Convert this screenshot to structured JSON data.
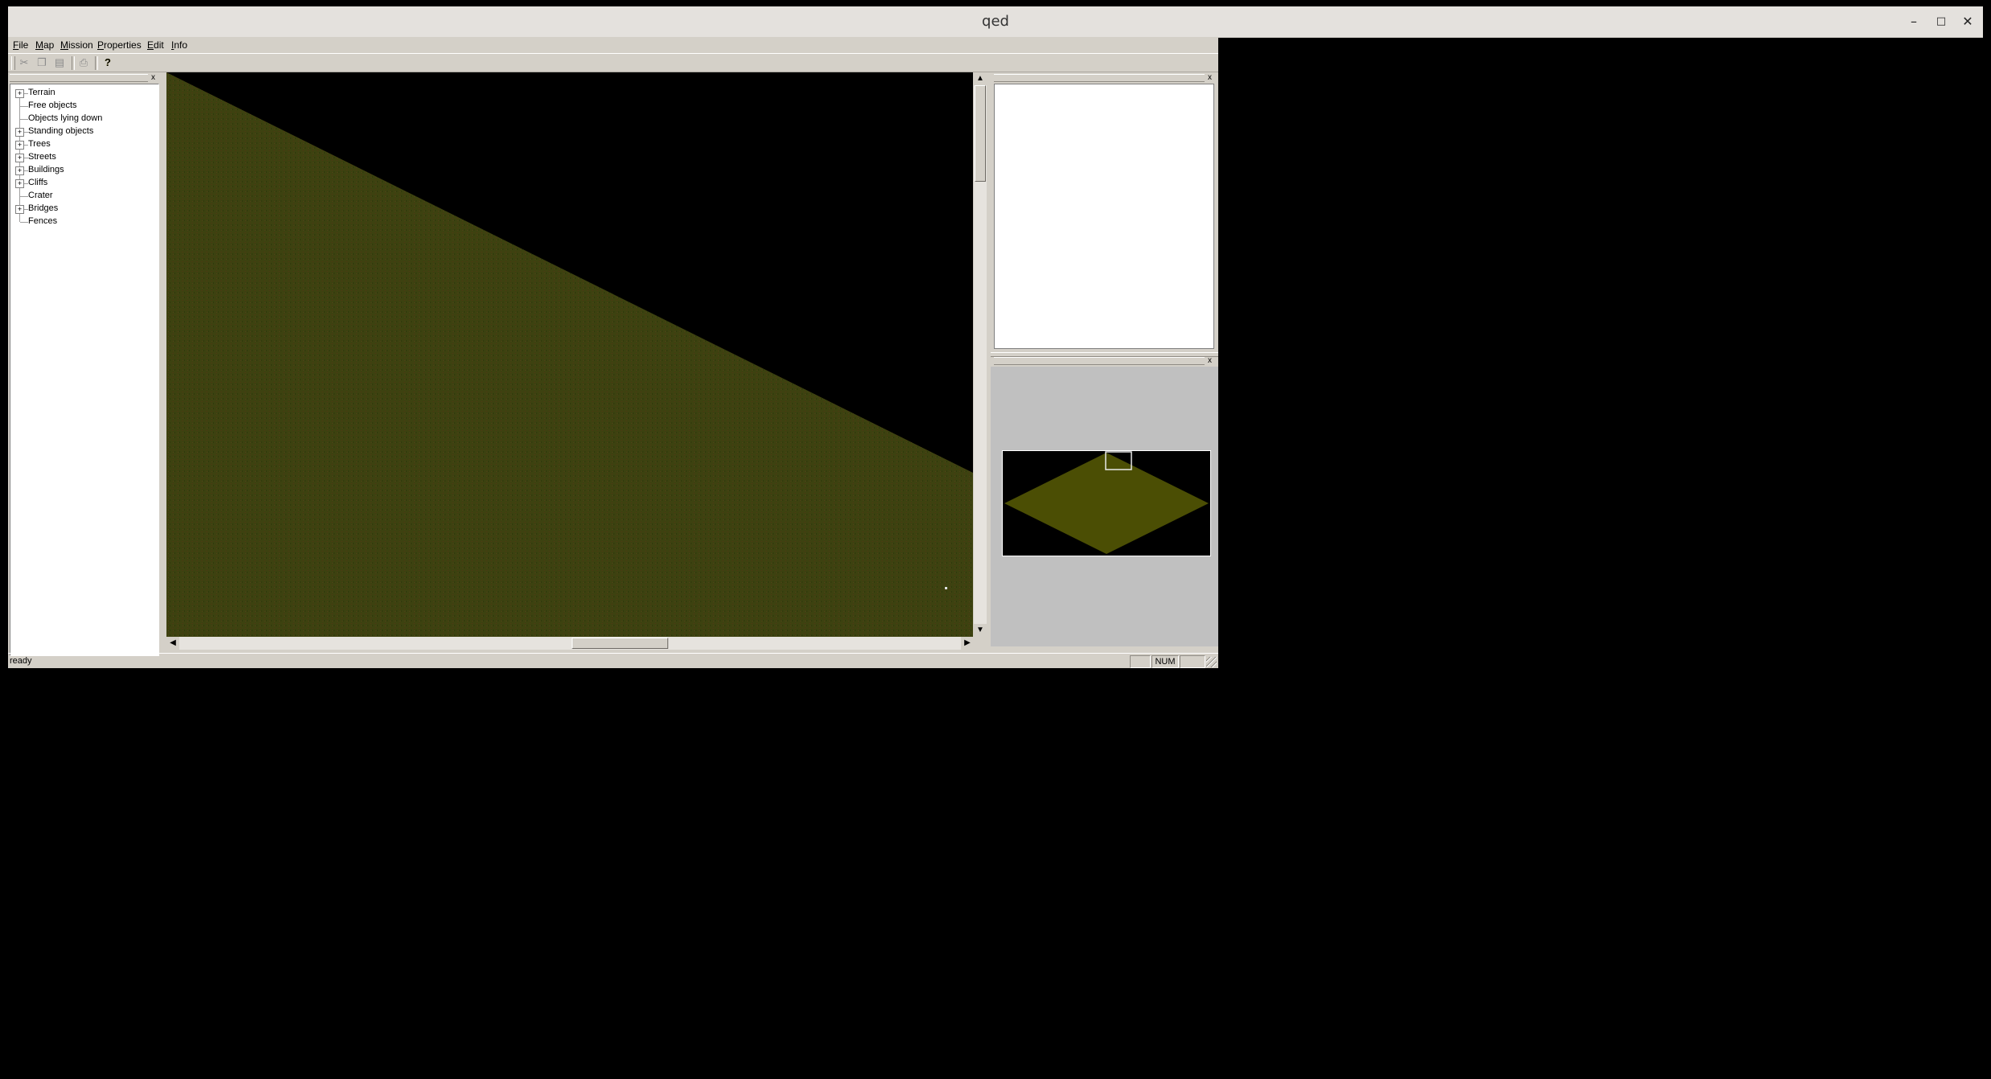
{
  "window": {
    "title": "qed",
    "controls": {
      "minimize": "–",
      "maximize": "□",
      "close": "✕"
    }
  },
  "menubar": {
    "items": [
      {
        "label": "File",
        "underline": "F"
      },
      {
        "label": "Map",
        "underline": "M"
      },
      {
        "label": "Mission",
        "underline": "M"
      },
      {
        "label": "Properties",
        "underline": "P"
      },
      {
        "label": "Edit",
        "underline": "E"
      },
      {
        "label": "Info",
        "underline": "I"
      }
    ]
  },
  "toolbar": {
    "buttons": [
      {
        "icon": "scissors-icon",
        "glyph": "✂"
      },
      {
        "icon": "copy-icon",
        "glyph": "❐"
      },
      {
        "icon": "paste-icon",
        "glyph": "▤"
      },
      {
        "icon": "print-icon",
        "glyph": "⎙"
      },
      {
        "icon": "help-icon",
        "glyph": "?"
      }
    ]
  },
  "object_tree": {
    "close": "x",
    "items": [
      {
        "label": "Terrain",
        "expandable": true
      },
      {
        "label": "Free objects",
        "expandable": false
      },
      {
        "label": "Objects lying down",
        "expandable": false
      },
      {
        "label": "Standing objects",
        "expandable": true
      },
      {
        "label": "Trees",
        "expandable": true
      },
      {
        "label": "Streets",
        "expandable": true
      },
      {
        "label": "Buildings",
        "expandable": true
      },
      {
        "label": "Cliffs",
        "expandable": true
      },
      {
        "label": "Crater",
        "expandable": false
      },
      {
        "label": "Bridges",
        "expandable": true
      },
      {
        "label": "Fences",
        "expandable": false
      }
    ]
  },
  "properties_panel": {
    "close": "x"
  },
  "minimap_panel": {
    "close": "x"
  },
  "statusbar": {
    "message": "ready",
    "num_indicator": "NUM"
  },
  "colors": {
    "terrain": "#3f4310",
    "minimap_terrain": "#4b4e04",
    "chrome": "#d4d0c8",
    "titlebar": "#e4e1dd"
  }
}
